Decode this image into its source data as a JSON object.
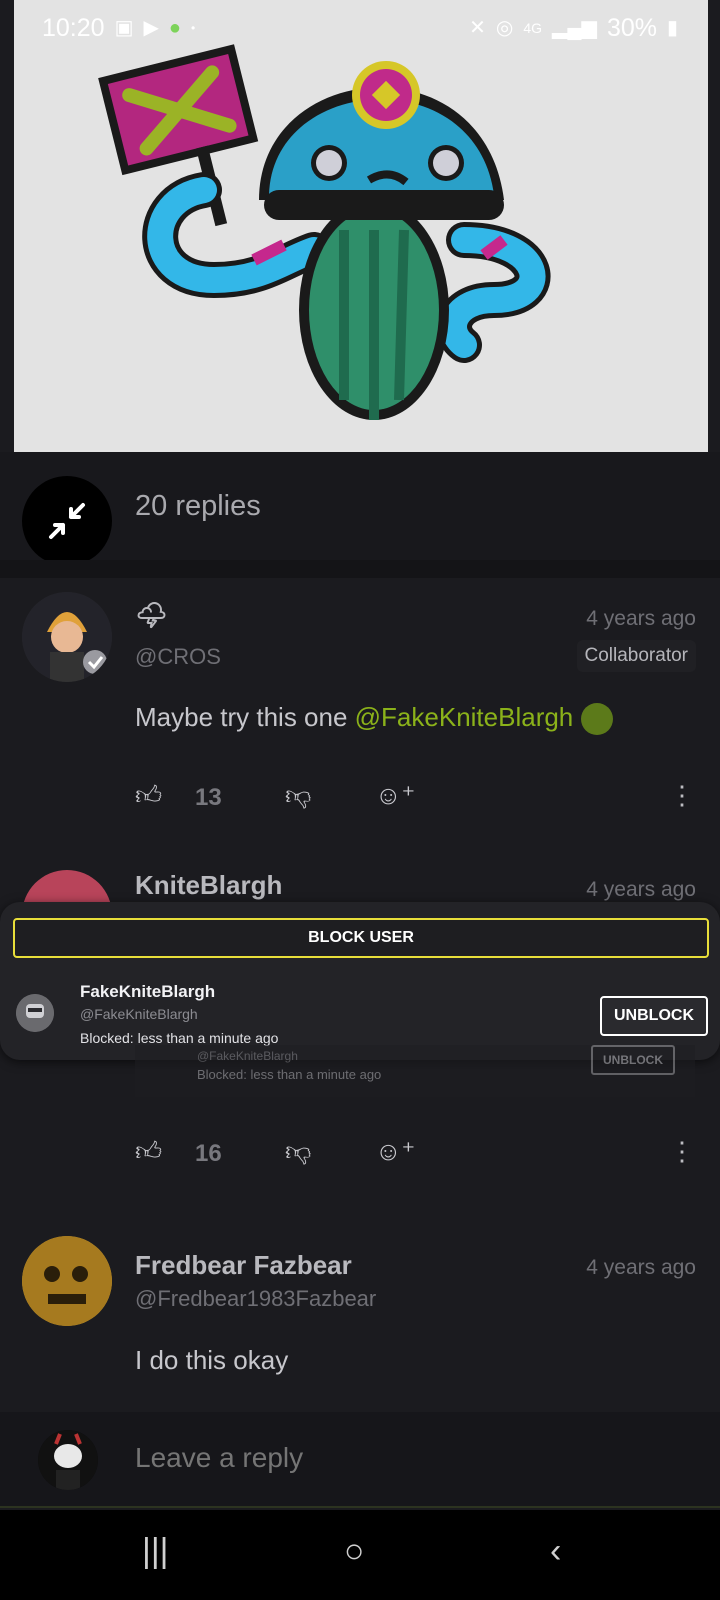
{
  "status_bar": {
    "time": "10:20",
    "battery": "30%",
    "icons_left": [
      "image-icon",
      "video-icon",
      "android-icon",
      "dot-icon"
    ],
    "icons_right": [
      "mute-icon",
      "hotspot-icon",
      "4g-icon",
      "signal-icon",
      "battery-icon"
    ]
  },
  "thread": {
    "replies_label": "20 replies"
  },
  "comments": [
    {
      "emoji": "🌩",
      "handle": "@CROS",
      "time": "4 years ago",
      "badge": "Collaborator",
      "text_prefix": "Maybe try this one ",
      "mention": "@FakeKniteBlargh",
      "likes": "13"
    },
    {
      "name": "KniteBlargh",
      "time": "4 years ago",
      "likes": "16",
      "embedded_block": {
        "handle": "@FakeKniteBlargh",
        "blocked": "Blocked: less than a minute ago",
        "button": "UNBLOCK"
      }
    },
    {
      "name": "Fredbear Fazbear",
      "handle": "@Fredbear1983Fazbear",
      "time": "4 years ago",
      "text": "I do this okay"
    }
  ],
  "block_panel": {
    "button_label": "BLOCK USER",
    "user_name": "FakeKniteBlargh",
    "user_handle": "@FakeKniteBlargh",
    "blocked_time": "Blocked: less than a minute ago",
    "unblock_label": "UNBLOCK"
  },
  "reply_box": {
    "placeholder": "Leave a reply"
  },
  "colors": {
    "background": "#1b1b1f",
    "mention": "#8bb21a",
    "block_border": "#e8de3a"
  }
}
